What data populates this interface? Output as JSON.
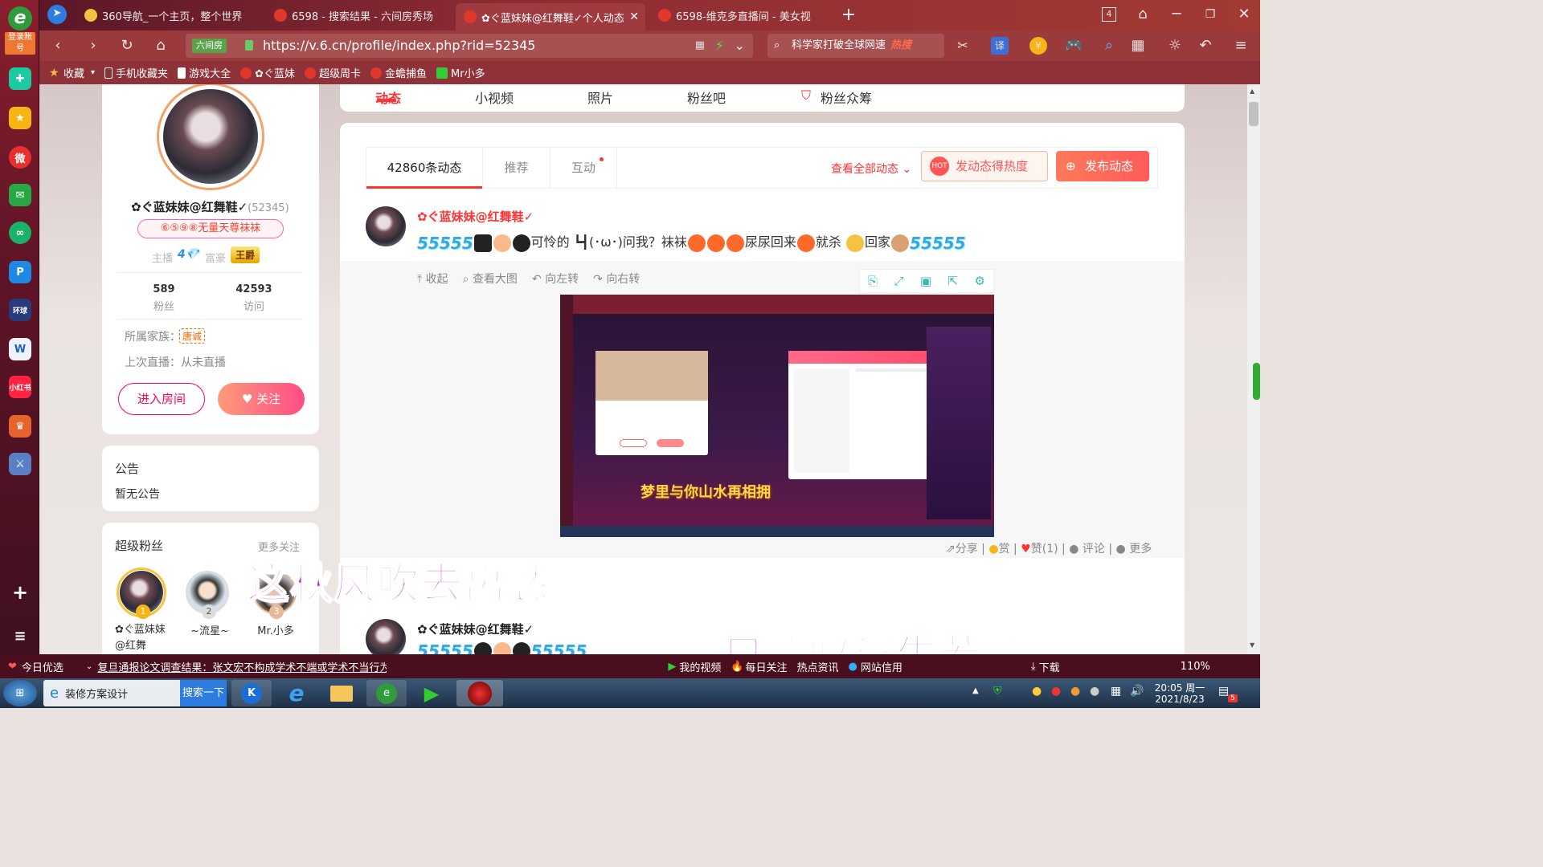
{
  "sidebar_left": {
    "login_label": "登录账号",
    "items": [
      "browser-app",
      "star",
      "weibo",
      "mail",
      "ai",
      "pdf",
      "news",
      "doc",
      "xiaohongshu",
      "game",
      "game2"
    ],
    "add_label": "+",
    "menu_label": "≡"
  },
  "tabs": [
    {
      "label": "360导航_一个主页，整个世界",
      "favicon": "#2e9c3b"
    },
    {
      "label": "6598 - 搜索结果 - 六间房秀场",
      "favicon": "#e0392b"
    },
    {
      "label": "✿ぐ蓝妹妹@红舞鞋✓个人动态",
      "favicon": "#e0392b",
      "active": true
    },
    {
      "label": "6598-维克多直播间 - 美女视",
      "favicon": "#e0392b"
    }
  ],
  "window_controls": {
    "tab_count": "4"
  },
  "address": {
    "site_badge": "六间房",
    "url": "https://v.6.cn/profile/index.php?rid=52345"
  },
  "search": {
    "text": "科学家打破全球网速",
    "hot": "热搜"
  },
  "bookmarks": [
    {
      "label": "收藏",
      "color": "#f5c242"
    },
    {
      "label": "手机收藏夹",
      "color": "#fff"
    },
    {
      "label": "游戏大全",
      "color": "#fff"
    },
    {
      "label": "✿ぐ蓝妹",
      "color": "#e0392b"
    },
    {
      "label": "超级周卡",
      "color": "#e0392b"
    },
    {
      "label": "金蟾捕鱼",
      "color": "#e0392b"
    },
    {
      "label": "Mr小多",
      "color": "#3c3"
    }
  ],
  "profile_tabs": [
    "动态",
    "小视频",
    "照片",
    "粉丝吧",
    "粉丝众筹"
  ],
  "profile": {
    "name": "✿ぐ蓝妹妹@红舞鞋✓",
    "rid": "(52345)",
    "title_badge": "⑥⑤⑨⑧无量天尊袜袜",
    "anchor_label": "主播",
    "anchor_level": "4",
    "rich_label": "富豪",
    "rich_level": "王爵",
    "fans_count": "589",
    "fans_label": "粉丝",
    "visits_count": "42593",
    "visits_label": "访问",
    "family_label": "所属家族：",
    "family_value": "唐诚",
    "last_live": "上次直播：从未直播",
    "enter_room": "进入房间",
    "follow": "关注"
  },
  "notice": {
    "title": "公告",
    "body": "暂无公告"
  },
  "super_fans": {
    "title": "超级粉丝",
    "more": "更多关注",
    "fans": [
      {
        "rank": "1",
        "name": "✿ぐ蓝妹妹@红舞"
      },
      {
        "rank": "2",
        "name": "~流星~"
      },
      {
        "rank": "3",
        "name": "Mr.小多"
      }
    ]
  },
  "feed": {
    "tabs": [
      "42860条动态",
      "推荐",
      "互动"
    ],
    "view_all": "查看全部动态",
    "hot_button": "发动态得热度",
    "publish_button": "发布动态",
    "post": {
      "author": "✿ぐ蓝妹妹@红舞鞋✓",
      "text_parts": [
        "可怜的",
        "┗┫(･ω･)",
        "问我？袜袜",
        "尿尿回来",
        "就杀",
        "回家"
      ],
      "tools": [
        "收起",
        "查看大图",
        "向左转",
        "向右转"
      ],
      "image_caption": "梦里与你山水再相拥",
      "actions": [
        "分享",
        "赏",
        "赞(1)",
        "评论",
        "更多"
      ]
    },
    "post2": {
      "author": "✿ぐ蓝妹妹@红舞鞋✓"
    }
  },
  "overlays": {
    "line1": "这秋风吹去离愁",
    "line2": "只感叹浮生若梦"
  },
  "statusbar": {
    "today": "今日优选",
    "news": "复旦通报论文调查结果：张文宏不构成学术不端或学术不当行为！",
    "my_video": "我的视频",
    "daily": "每日关注",
    "hot_news": "热点资讯",
    "credit": "网站信用",
    "download": "下载",
    "zoom": "110%"
  },
  "taskbar": {
    "task1": "装修方案设计",
    "task1_btn": "搜索一下",
    "time": "20:05 周一",
    "date": "2021/8/23",
    "notif": "5"
  }
}
